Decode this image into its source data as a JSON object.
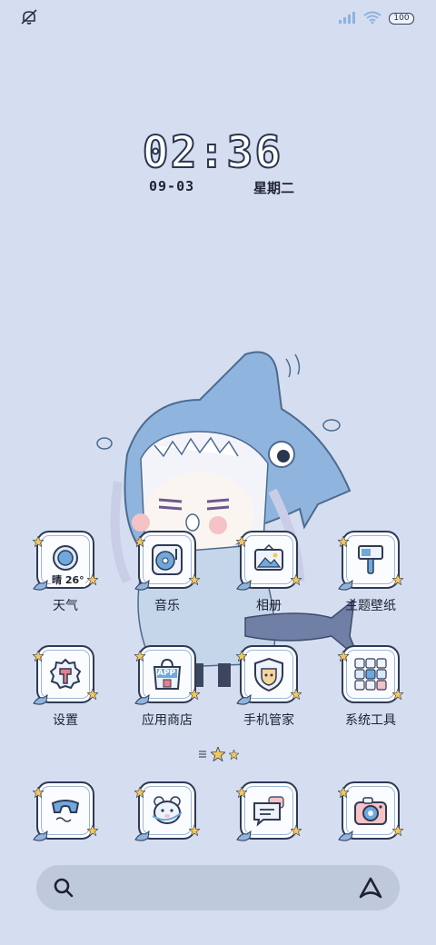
{
  "status_bar": {
    "battery_level": "100",
    "icons": [
      "mute-bell-icon",
      "signal-icon",
      "wifi-icon",
      "battery-icon"
    ]
  },
  "clock": {
    "time": "02:36",
    "date": "09-03",
    "weekday": "星期二"
  },
  "apps_row1": [
    {
      "label": "天气",
      "icon": "weather-icon",
      "badge": "晴 26°"
    },
    {
      "label": "音乐",
      "icon": "music-icon"
    },
    {
      "label": "相册",
      "icon": "gallery-icon"
    },
    {
      "label": "主题壁纸",
      "icon": "theme-icon"
    }
  ],
  "apps_row2": [
    {
      "label": "设置",
      "icon": "settings-icon"
    },
    {
      "label": "应用商店",
      "icon": "app-store-icon",
      "badge": "APP"
    },
    {
      "label": "手机管家",
      "icon": "phone-manager-icon"
    },
    {
      "label": "系统工具",
      "icon": "system-tools-icon"
    }
  ],
  "dock": [
    {
      "icon": "phone-icon"
    },
    {
      "icon": "contacts-icon"
    },
    {
      "icon": "messages-icon"
    },
    {
      "icon": "camera-icon"
    }
  ],
  "colors": {
    "background": "#d4def0",
    "tile_border": "#2f3a55",
    "accent_blue": "#6fa8dc",
    "star_yellow": "#f5c85a",
    "search_bar": "#bfc9dc"
  }
}
